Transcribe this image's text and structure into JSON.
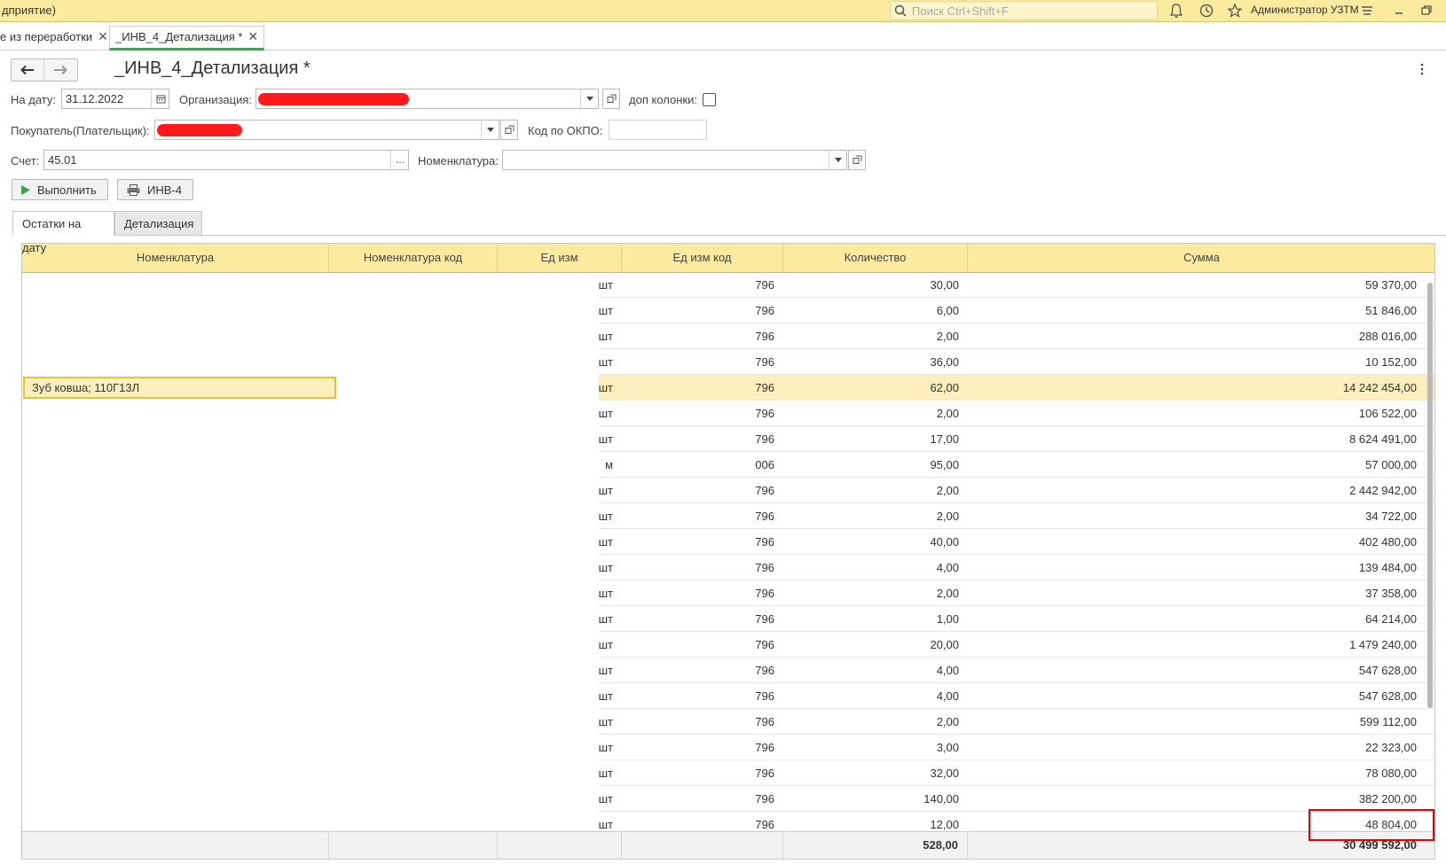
{
  "app": {
    "title": "дприятие)",
    "search_placeholder": "Поиск Ctrl+Shift+F",
    "user": "Администратор УЗТМ"
  },
  "window_tabs": [
    {
      "label": "е из переработки"
    },
    {
      "label": "_ИНВ_4_Детализация *"
    }
  ],
  "form": {
    "title": "_ИНВ_4_Детализация *",
    "date_label": "На дату:",
    "date_value": "31.12.2022",
    "org_label": "Организация:",
    "extra_cols_label": "доп колонки:",
    "buyer_label": "Покупатель(Плательщик):",
    "okpo_label": "Код по ОКПО:",
    "okpo_value": "",
    "account_label": "Счет:",
    "account_value": "45.01",
    "nomenclature_label": "Номенклатура:",
    "nomenclature_value": "",
    "run_button": "Выполнить",
    "print_button": "ИНВ-4"
  },
  "tabs": [
    {
      "label": "Остатки на дату"
    },
    {
      "label": "Детализация"
    }
  ],
  "table": {
    "columns": [
      "Номенклатура",
      "Номенклатура код",
      "Ед изм",
      "Ед изм код",
      "Количество",
      "Сумма"
    ],
    "rows": [
      {
        "name": "",
        "code": "",
        "unit": "шт",
        "unit_code": "796",
        "qty": "30,00",
        "sum": "59 370,00"
      },
      {
        "name": "",
        "code": "",
        "unit": "шт",
        "unit_code": "796",
        "qty": "6,00",
        "sum": "51 846,00"
      },
      {
        "name": "",
        "code": "",
        "unit": "шт",
        "unit_code": "796",
        "qty": "2,00",
        "sum": "288 016,00"
      },
      {
        "name": "",
        "code": "",
        "unit": "шт",
        "unit_code": "796",
        "qty": "36,00",
        "sum": "10 152,00"
      },
      {
        "name": "Зуб ковша; 110Г13Л",
        "code": "",
        "unit": "шт",
        "unit_code": "796",
        "qty": "62,00",
        "sum": "14 242 454,00",
        "selected": true
      },
      {
        "name": "",
        "code": "",
        "unit": "шт",
        "unit_code": "796",
        "qty": "2,00",
        "sum": "106 522,00"
      },
      {
        "name": "",
        "code": "",
        "unit": "шт",
        "unit_code": "796",
        "qty": "17,00",
        "sum": "8 624 491,00"
      },
      {
        "name": "",
        "code": "",
        "unit": "м",
        "unit_code": "006",
        "qty": "95,00",
        "sum": "57 000,00"
      },
      {
        "name": "",
        "code": "",
        "unit": "шт",
        "unit_code": "796",
        "qty": "2,00",
        "sum": "2 442 942,00"
      },
      {
        "name": "",
        "code": "",
        "unit": "шт",
        "unit_code": "796",
        "qty": "2,00",
        "sum": "34 722,00"
      },
      {
        "name": "",
        "code": "",
        "unit": "шт",
        "unit_code": "796",
        "qty": "40,00",
        "sum": "402 480,00"
      },
      {
        "name": "",
        "code": "",
        "unit": "шт",
        "unit_code": "796",
        "qty": "4,00",
        "sum": "139 484,00"
      },
      {
        "name": "",
        "code": "",
        "unit": "шт",
        "unit_code": "796",
        "qty": "2,00",
        "sum": "37 358,00"
      },
      {
        "name": "",
        "code": "",
        "unit": "шт",
        "unit_code": "796",
        "qty": "1,00",
        "sum": "64 214,00"
      },
      {
        "name": "",
        "code": "",
        "unit": "шт",
        "unit_code": "796",
        "qty": "20,00",
        "sum": "1 479 240,00"
      },
      {
        "name": "",
        "code": "",
        "unit": "шт",
        "unit_code": "796",
        "qty": "4,00",
        "sum": "547 628,00"
      },
      {
        "name": "",
        "code": "",
        "unit": "шт",
        "unit_code": "796",
        "qty": "4,00",
        "sum": "547 628,00"
      },
      {
        "name": "",
        "code": "",
        "unit": "шт",
        "unit_code": "796",
        "qty": "2,00",
        "sum": "599 112,00"
      },
      {
        "name": "",
        "code": "",
        "unit": "шт",
        "unit_code": "796",
        "qty": "3,00",
        "sum": "22 323,00"
      },
      {
        "name": "",
        "code": "",
        "unit": "шт",
        "unit_code": "796",
        "qty": "32,00",
        "sum": "78 080,00"
      },
      {
        "name": "",
        "code": "",
        "unit": "шт",
        "unit_code": "796",
        "qty": "140,00",
        "sum": "382 200,00"
      },
      {
        "name": "",
        "code": "",
        "unit": "шт",
        "unit_code": "796",
        "qty": "12,00",
        "sum": "48 804,00"
      }
    ],
    "totals": {
      "qty": "528,00",
      "sum": "30 499 592,00"
    }
  },
  "colors": {
    "header_yellow": "#fbeb9f",
    "selection": "#fcefbd",
    "redaction": "#ff1a1a",
    "highlight_box": "#e60000",
    "active_tab_underline": "#4a9e5c"
  }
}
